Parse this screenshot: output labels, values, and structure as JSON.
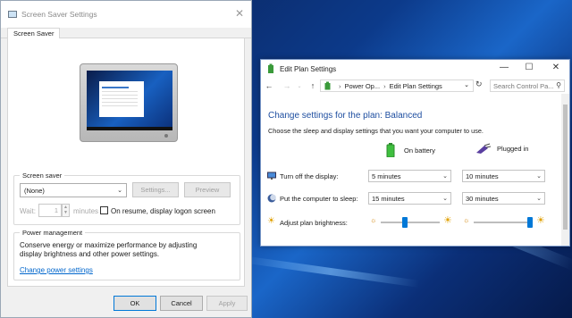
{
  "screen_saver_dialog": {
    "title": "Screen Saver Settings",
    "tab": "Screen Saver",
    "group_screen_saver": {
      "legend": "Screen saver",
      "selected": "(None)",
      "settings_button": "Settings...",
      "preview_button": "Preview",
      "wait_label": "Wait:",
      "wait_value": "1",
      "minutes_label": "minutes",
      "logon_checkbox_label": "On resume, display logon screen"
    },
    "group_power": {
      "legend": "Power management",
      "description_line1": "Conserve energy or maximize performance by adjusting",
      "description_line2": "display brightness and other power settings.",
      "link": "Change power settings"
    },
    "buttons": {
      "ok": "OK",
      "cancel": "Cancel",
      "apply": "Apply"
    }
  },
  "edit_plan_window": {
    "title": "Edit Plan Settings",
    "breadcrumb": [
      "Power Op...",
      "Edit Plan Settings"
    ],
    "search_placeholder": "Search Control Pa...",
    "heading": "Change settings for the plan: Balanced",
    "description": "Choose the sleep and display settings that you want your computer to use.",
    "columns": {
      "on_battery": "On battery",
      "plugged_in": "Plugged in"
    },
    "rows": [
      {
        "label": "Turn off the display:",
        "on_battery": "5 minutes",
        "plugged_in": "10 minutes"
      },
      {
        "label": "Put the computer to sleep:",
        "on_battery": "15 minutes",
        "plugged_in": "30 minutes"
      }
    ],
    "brightness": {
      "label": "Adjust plan brightness:",
      "on_battery_level": 0.4,
      "plugged_in_level": 1.0
    }
  },
  "colors": {
    "accent": "#0078d7",
    "heading": "#1e4ea0",
    "link": "#0066cc"
  }
}
